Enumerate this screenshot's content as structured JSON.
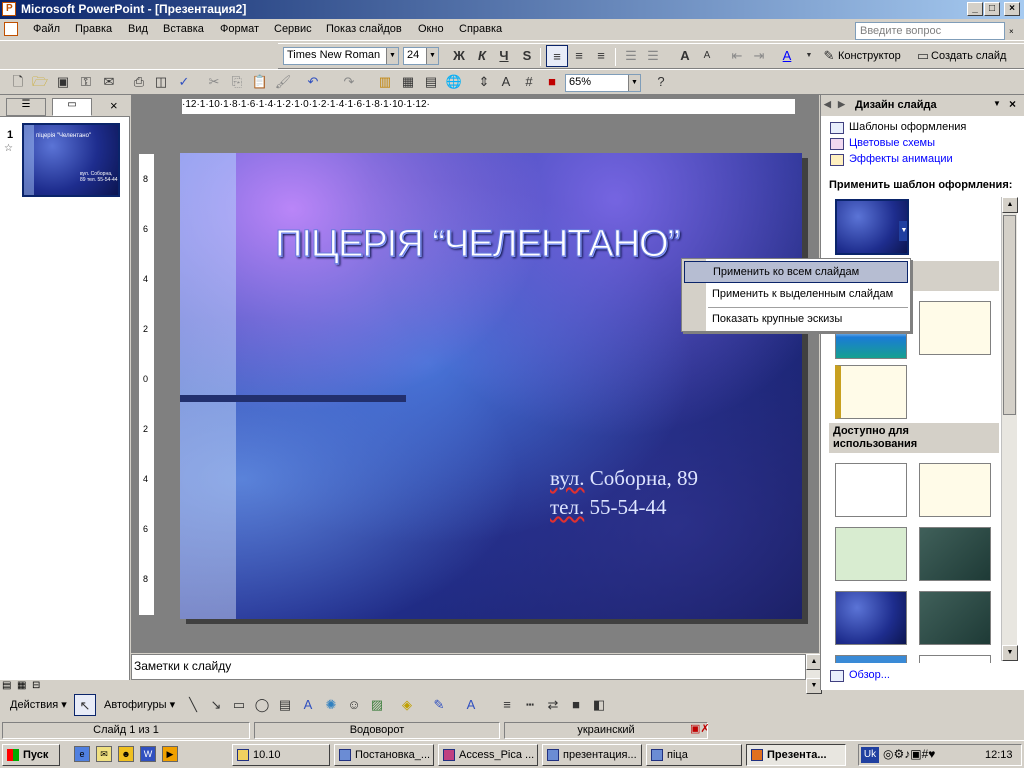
{
  "window": {
    "title": "Microsoft PowerPoint - [Презентация2]",
    "min": "_",
    "max": "□",
    "close": "×"
  },
  "menu": {
    "items": [
      "Файл",
      "Правка",
      "Вид",
      "Вставка",
      "Формат",
      "Сервис",
      "Показ слайдов",
      "Окно",
      "Справка"
    ],
    "ask_placeholder": "Введите вопрос"
  },
  "format_toolbar": {
    "font": "Times New Roman",
    "size": "24",
    "bold": "Ж",
    "italic": "К",
    "underline": "Ч",
    "shadow": "S",
    "designer_label": "Конструктор",
    "new_slide_label": "Создать слайд"
  },
  "standard_toolbar": {
    "zoom": "65%"
  },
  "left_pane": {
    "slide_number": "1",
    "thumb_title": "піцерія \"Челентано\"",
    "thumb_sub": "вул. Соборна, 89 тел. 55-54-44"
  },
  "slide": {
    "title": "ПІЦЕРІЯ “ЧЕЛЕНТАНО”",
    "address_prefix": "вул.",
    "address_rest": "  Соборна, 89",
    "phone_prefix": "тел.",
    "phone_rest": " 55-54-44"
  },
  "rulers": {
    "h": "·12·1·10·1·8·1·6·1·4·1·2·1·0·1·2·1·4·1·6·1·8·1·10·1·12·",
    "v": [
      "8",
      "6",
      "4",
      "2",
      "0",
      "2",
      "4",
      "6",
      "8"
    ]
  },
  "notes": {
    "placeholder": "Заметки к слайду"
  },
  "task_pane": {
    "title": "Дизайн слайда",
    "links": [
      "Шаблоны оформления",
      "Цветовые схемы",
      "Эффекты анимации"
    ],
    "apply_heading": "Применить шаблон оформления:",
    "recent_tail": "ые",
    "available_heading": "Доступно для использования",
    "browse": "Обзор..."
  },
  "context_menu": {
    "items": [
      "Применить ко всем слайдам",
      "Применить к выделенным слайдам",
      "Показать крупные эскизы"
    ],
    "selected": 0
  },
  "draw_toolbar": {
    "actions": "Действия",
    "autoshapes": "Автофигуры"
  },
  "status": {
    "slide": "Слайд 1 из 1",
    "design": "Водоворот",
    "language": "украинский"
  },
  "taskbar": {
    "start": "Пуск",
    "apps": [
      "10.10",
      "Постановка_...",
      "Access_Pica ...",
      "презентация...",
      "піца",
      "Презента..."
    ],
    "time": "12:13",
    "lang": "Uk"
  }
}
